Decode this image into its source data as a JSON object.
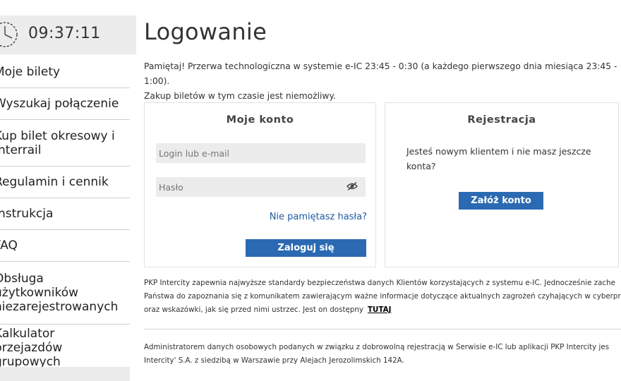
{
  "clock": {
    "time": "09:37:11"
  },
  "sidebar": {
    "items": [
      {
        "label": "Moje bilety"
      },
      {
        "label": "Wyszukaj połączenie"
      },
      {
        "label": "Kup bilet okresowy i Interrail"
      },
      {
        "label": "Regulamin i cennik"
      },
      {
        "label": "Instrukcja"
      },
      {
        "label": "FAQ"
      },
      {
        "label": "Obsługa użytkowników niezarejestrowanych"
      },
      {
        "label": "Kalkulator przejazdów grupowych"
      }
    ]
  },
  "main": {
    "title": "Logowanie",
    "notice_line1": "Pamiętaj! Przerwa technologiczna w systemie e-IC 23:45 - 0:30 (a każdego pierwszego dnia miesiąca 23:45 - 1:00).",
    "notice_line2": "Zakup biletów w tym czasie jest niemożliwy."
  },
  "login": {
    "title": "Moje konto",
    "login_placeholder": "Login lub e-mail",
    "password_placeholder": "Hasło",
    "forgot_label": "Nie pamiętasz hasła?",
    "submit_label": "Zaloguj się"
  },
  "register": {
    "title": "Rejestracja",
    "text": "Jesteś nowym klientem i nie masz jeszcze konta?",
    "button_label": "Załóż konto"
  },
  "security": {
    "line1": "PKP Intercity zapewnia najwyższe standardy bezpieczeństwa danych Klientów korzystających z systemu e-IC. Jednocześnie zache",
    "line2": "Państwa do zapoznania się z komunikatem zawierającym ważne informacje dotyczące aktualnych zagrożeń czyhających w cyberprzes",
    "line3": "oraz wskazówki, jak się przed nimi ustrzec. Jest on dostępny",
    "link": "TUTAJ"
  },
  "admin": {
    "line1": "Administratorem danych osobowych podanych w związku z dobrowolną rejestracją w Serwisie e-IC lub aplikacji PKP Intercity jes",
    "line2": "Intercity' S.A. z siedzibą w Warszawie przy Alejach Jerozolimskich 142A."
  },
  "colors": {
    "accent": "#2b6ab2",
    "link": "#1e5aa0",
    "input_bg": "#ececec"
  }
}
